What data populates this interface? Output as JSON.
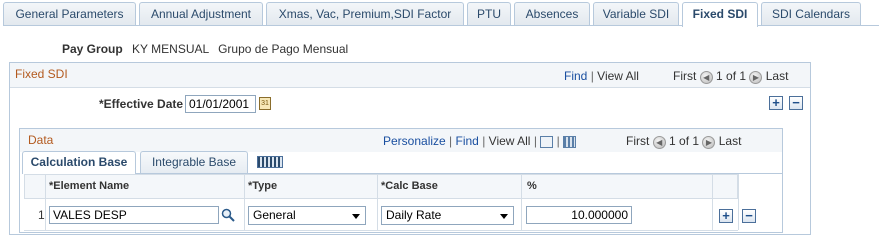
{
  "tabs": [
    {
      "label": "General Parameters",
      "active": false
    },
    {
      "label": "Annual Adjustment",
      "active": false
    },
    {
      "label": "Xmas, Vac, Premium,SDI Factor",
      "active": false
    },
    {
      "label": "PTU",
      "active": false
    },
    {
      "label": "Absences",
      "active": false
    },
    {
      "label": "Variable SDI",
      "active": false
    },
    {
      "label": "Fixed SDI",
      "active": true
    },
    {
      "label": "SDI Calendars",
      "active": false
    }
  ],
  "pay_group": {
    "label": "Pay Group",
    "code": "KY MENSUAL",
    "description": "Grupo de Pago Mensual"
  },
  "fixed_sdi": {
    "title": "Fixed SDI",
    "find": "Find",
    "view_all": "View All",
    "first": "First",
    "range": "1 of 1",
    "last": "Last",
    "effective_date_label": "*Effective Date",
    "effective_date": "01/01/2001"
  },
  "data": {
    "title": "Data",
    "personalize": "Personalize",
    "find": "Find",
    "view_all": "View All",
    "first": "First",
    "range": "1 of 1",
    "last": "Last",
    "subtabs": [
      {
        "label": "Calculation Base",
        "active": true
      },
      {
        "label": "Integrable Base",
        "active": false
      }
    ],
    "columns": [
      "*Element Name",
      "*Type",
      "*Calc Base",
      "%"
    ],
    "rows": [
      {
        "num": "1",
        "element_name": "VALES DESP",
        "type": "General",
        "calc_base": "Daily Rate",
        "percent": "10.000000"
      }
    ]
  },
  "colors": {
    "tab_border": "#b7c9dc",
    "link": "#1a4fa0",
    "group_title": "#b35a1f"
  },
  "icons": [
    "calendar-icon",
    "lookup-icon",
    "add-icon",
    "delete-icon",
    "show-all-tabs-icon",
    "download-icon",
    "zoom-icon",
    "prev-icon",
    "next-icon"
  ]
}
